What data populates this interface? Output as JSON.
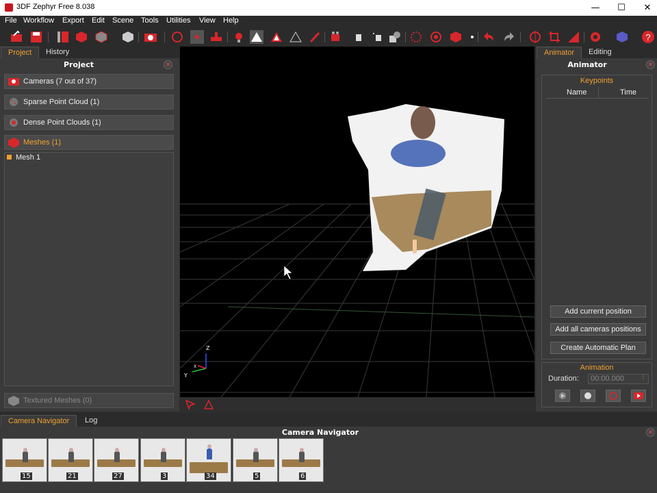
{
  "window": {
    "title": "3DF Zephyr Free 8.038",
    "minimize": "—",
    "maximize": "☐",
    "close": "✕"
  },
  "menu": [
    "File",
    "Workflow",
    "Export",
    "Edit",
    "Scene",
    "Tools",
    "Utilities",
    "View",
    "Help"
  ],
  "toolbar_icons": [
    "new-project-icon",
    "save-icon",
    "workflow-icon",
    "cube-icon",
    "mesh-icon",
    "textured-mesh-icon",
    "camera-icon",
    "rotate-icon",
    "point-icon",
    "gizmo-icon",
    "light-icon",
    "triangle-icon",
    "triangle-red-icon",
    "triangle-outline-icon",
    "brush-icon",
    "camera-film-icon",
    "hand-icon",
    "move-icon",
    "shapes-icon",
    "sphere-grid-icon",
    "sphere-icon",
    "box-icon",
    "dot-icon",
    "undo-icon",
    "redo-icon",
    "orbit-icon",
    "crop-icon",
    "ruler-icon",
    "settings-icon",
    "cube-logo-icon",
    "help-icon"
  ],
  "left_panel": {
    "tabs": [
      "Project",
      "History"
    ],
    "title": "Project",
    "sections": [
      {
        "label": "Cameras (7 out of 37)",
        "icon": "camera-icon",
        "active": false
      },
      {
        "label": "Sparse Point Cloud (1)",
        "icon": "sparse-cloud-icon",
        "active": false
      },
      {
        "label": "Dense Point Clouds (1)",
        "icon": "dense-cloud-icon",
        "active": false
      },
      {
        "label": "Meshes (1)",
        "icon": "mesh-icon",
        "active": true
      }
    ],
    "tree_items": [
      "Mesh 1"
    ],
    "textured_meshes": "Textured Meshes (0)"
  },
  "viewport": {
    "axes": {
      "z": "Z",
      "y": "Y",
      "x": "X"
    }
  },
  "right_panel": {
    "tabs": [
      "Animator",
      "Editing"
    ],
    "title": "Animator",
    "keypoints": {
      "title": "Keypoints",
      "columns": [
        "Name",
        "Time"
      ]
    },
    "buttons": [
      "Add current position",
      "Add all cameras positions",
      "Create Automatic Plan"
    ],
    "animation": {
      "title": "Animation",
      "duration_label": "Duration:",
      "duration_value": "00:00.000"
    },
    "playback_icons": [
      "play-icon",
      "record-icon",
      "stop-icon",
      "video-icon"
    ]
  },
  "bottom": {
    "tabs": [
      "Camera Navigator",
      "Log"
    ],
    "title": "Camera Navigator",
    "thumbnails": [
      "15",
      "21",
      "27",
      "3",
      "34",
      "5",
      "6"
    ]
  },
  "colors": {
    "accent": "#f0a030",
    "red": "#c8171e",
    "panel": "#3a3a3a"
  }
}
